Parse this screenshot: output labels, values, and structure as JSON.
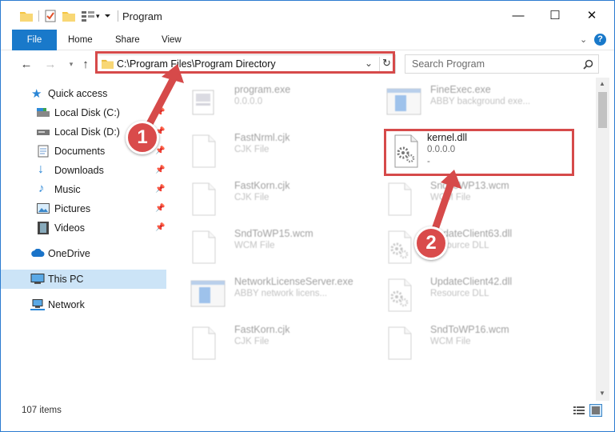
{
  "window": {
    "title": "Program",
    "controls": {
      "minimize": "—",
      "maximize": "☐",
      "close": "✕"
    }
  },
  "ribbon": {
    "tabs": [
      "File",
      "Home",
      "Share",
      "View"
    ],
    "help_icon": "?"
  },
  "addressbar": {
    "path": "C:\\Program Files\\Program Directory",
    "search_placeholder": "Search Program"
  },
  "sidebar": {
    "items": [
      {
        "label": "Quick access",
        "icon": "star-icon",
        "pinned": false,
        "selected": false
      },
      {
        "label": "Local Disk (C:)",
        "icon": "drive-icon",
        "pinned": true,
        "selected": false
      },
      {
        "label": "Local Disk (D:)",
        "icon": "drive-icon",
        "pinned": true,
        "selected": false
      },
      {
        "label": "Documents",
        "icon": "documents-icon",
        "pinned": true,
        "selected": false
      },
      {
        "label": "Downloads",
        "icon": "download-icon",
        "pinned": true,
        "selected": false
      },
      {
        "label": "Music",
        "icon": "music-icon",
        "pinned": true,
        "selected": false
      },
      {
        "label": "Pictures",
        "icon": "pictures-icon",
        "pinned": true,
        "selected": false
      },
      {
        "label": "Videos",
        "icon": "videos-icon",
        "pinned": true,
        "selected": false
      },
      {
        "label": "OneDrive",
        "icon": "cloud-icon",
        "pinned": false,
        "selected": false
      },
      {
        "label": "This PC",
        "icon": "computer-icon",
        "pinned": false,
        "selected": true
      },
      {
        "label": "Network",
        "icon": "network-icon",
        "pinned": false,
        "selected": false
      }
    ]
  },
  "files": [
    {
      "name": "program.exe",
      "sub": "0.0.0.0",
      "sub2": "",
      "icon": "exe-icon",
      "highlighted": false
    },
    {
      "name": "FineExec.exe",
      "sub": "ABBY background exe...",
      "sub2": "",
      "icon": "app-window-icon",
      "highlighted": false
    },
    {
      "name": "FastNrml.cjk",
      "sub": "CJK File",
      "sub2": "",
      "icon": "blank-file-icon",
      "highlighted": false
    },
    {
      "name": "kernel.dll",
      "sub": "0.0.0.0",
      "sub2": "-",
      "icon": "dll-gear-icon",
      "highlighted": true
    },
    {
      "name": "FastKorn.cjk",
      "sub": "CJK File",
      "sub2": "",
      "icon": "blank-file-icon",
      "highlighted": false
    },
    {
      "name": "SndToWP13.wcm",
      "sub": "WCM File",
      "sub2": "",
      "icon": "blank-file-icon",
      "highlighted": false
    },
    {
      "name": "SndToWP15.wcm",
      "sub": "WCM File",
      "sub2": "",
      "icon": "blank-file-icon",
      "highlighted": false
    },
    {
      "name": "UpdateClient63.dll",
      "sub": "Resource DLL",
      "sub2": "",
      "icon": "dll-gear-icon",
      "highlighted": false
    },
    {
      "name": "NetworkLicenseServer.exe",
      "sub": "ABBY network licens...",
      "sub2": "",
      "icon": "app-window-icon",
      "highlighted": false
    },
    {
      "name": "UpdateClient42.dll",
      "sub": "Resource DLL",
      "sub2": "",
      "icon": "dll-gear-icon",
      "highlighted": false
    },
    {
      "name": "FastKorn.cjk",
      "sub": "CJK File",
      "sub2": "",
      "icon": "blank-file-icon",
      "highlighted": false
    },
    {
      "name": "SndToWP16.wcm",
      "sub": "WCM File",
      "sub2": "",
      "icon": "blank-file-icon",
      "highlighted": false
    }
  ],
  "status": {
    "item_count": "107 items"
  },
  "annotations": {
    "marker1": "1",
    "marker2": "2",
    "color": "#d64a4a"
  }
}
